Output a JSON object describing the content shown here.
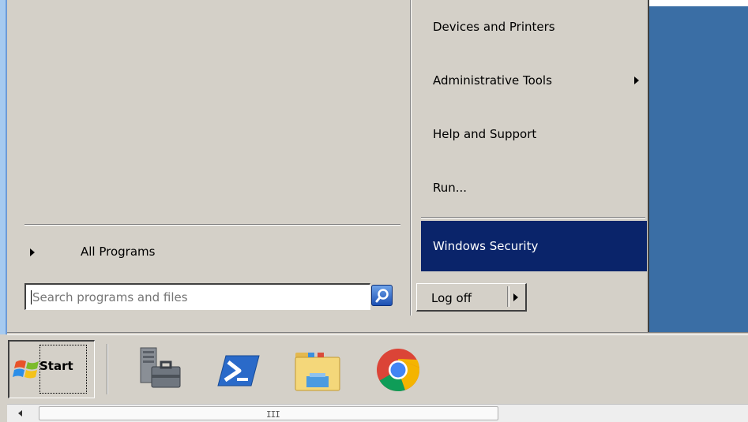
{
  "start_menu": {
    "all_programs_label": "All Programs",
    "search": {
      "placeholder": "Search programs and files",
      "value": ""
    },
    "right_items": [
      {
        "label": "Devices and Printers"
      },
      {
        "label": "Administrative Tools",
        "has_submenu": true
      },
      {
        "label": "Help and Support"
      },
      {
        "label": "Run..."
      },
      {
        "label": "Windows Security",
        "selected": true
      }
    ],
    "logoff_label": "Log off"
  },
  "taskbar": {
    "start_label": "Start",
    "pinned_icons": [
      "server-manager-icon",
      "powershell-icon",
      "file-explorer-icon",
      "chrome-icon"
    ]
  },
  "scrollbar": {
    "grip": "III"
  },
  "colors": {
    "desktop": "#3a6ea5",
    "selection": "#0a246a",
    "menu_bg": "#d4d0c8"
  }
}
